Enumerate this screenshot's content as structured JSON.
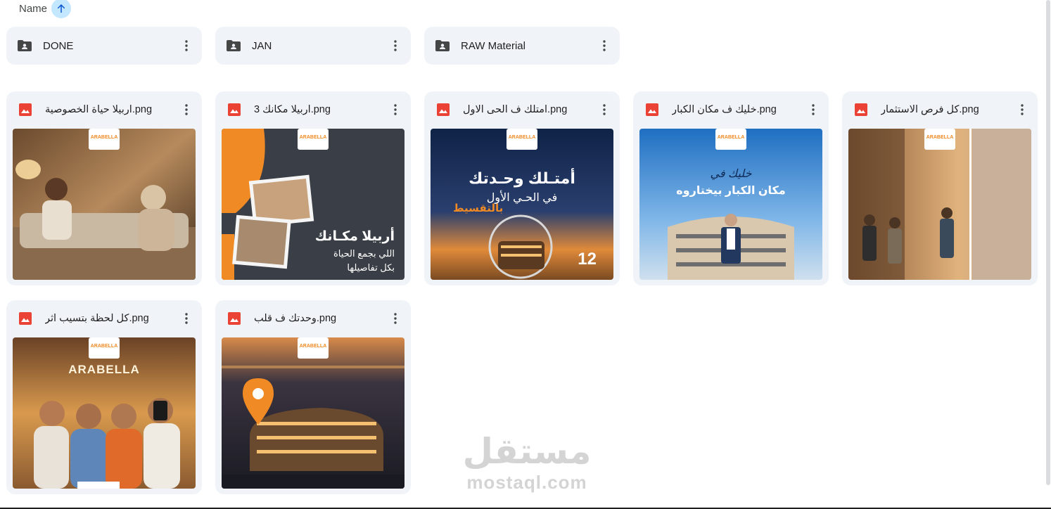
{
  "sort": {
    "label": "Name",
    "direction": "ascending"
  },
  "folders": [
    {
      "name": "DONE"
    },
    {
      "name": "JAN"
    },
    {
      "name": "RAW Material"
    }
  ],
  "files": [
    {
      "name": "اربيلا حياة الخصوصية.png",
      "thumb": {
        "brand": "ARABELLA"
      }
    },
    {
      "name": "اربيلا مكانك 3.png",
      "thumb": {
        "brand": "ARABELLA",
        "headline": "أربيلا مكـانك",
        "sub1": "اللي بجمع الحياة",
        "sub2": "بكل تفاصيلها"
      }
    },
    {
      "name": "امتلك ف الحى الاول.png",
      "thumb": {
        "brand": "ARABELLA",
        "headline": "أمتـلك وحـدتك",
        "sub1": "في الحـي الأول",
        "sub2": "بالتقسيط",
        "badge": "12"
      }
    },
    {
      "name": "خليك ف مكان الكبار.png",
      "thumb": {
        "brand": "ARABELLA",
        "headline": "خليك في",
        "sub1": "مكان الكبار بيختاروه"
      }
    },
    {
      "name": "كل فرص الاستثمار.png",
      "thumb": {
        "brand": "ARABELLA"
      }
    },
    {
      "name": "كل لحظة بتسيب اثر.png",
      "thumb": {
        "brand": "ARABELLA",
        "sign": "ARABELLA"
      }
    },
    {
      "name": "وحدتك ف قلب.png",
      "thumb": {
        "brand": "ARABELLA"
      }
    }
  ],
  "watermark": {
    "arabic": "مستقل",
    "latin": "mostaql.com"
  },
  "colors": {
    "card_bg": "#f0f4f9",
    "accent": "#c2e7ff",
    "image_icon": "#ea4335",
    "brand_orange": "#f08a24"
  }
}
